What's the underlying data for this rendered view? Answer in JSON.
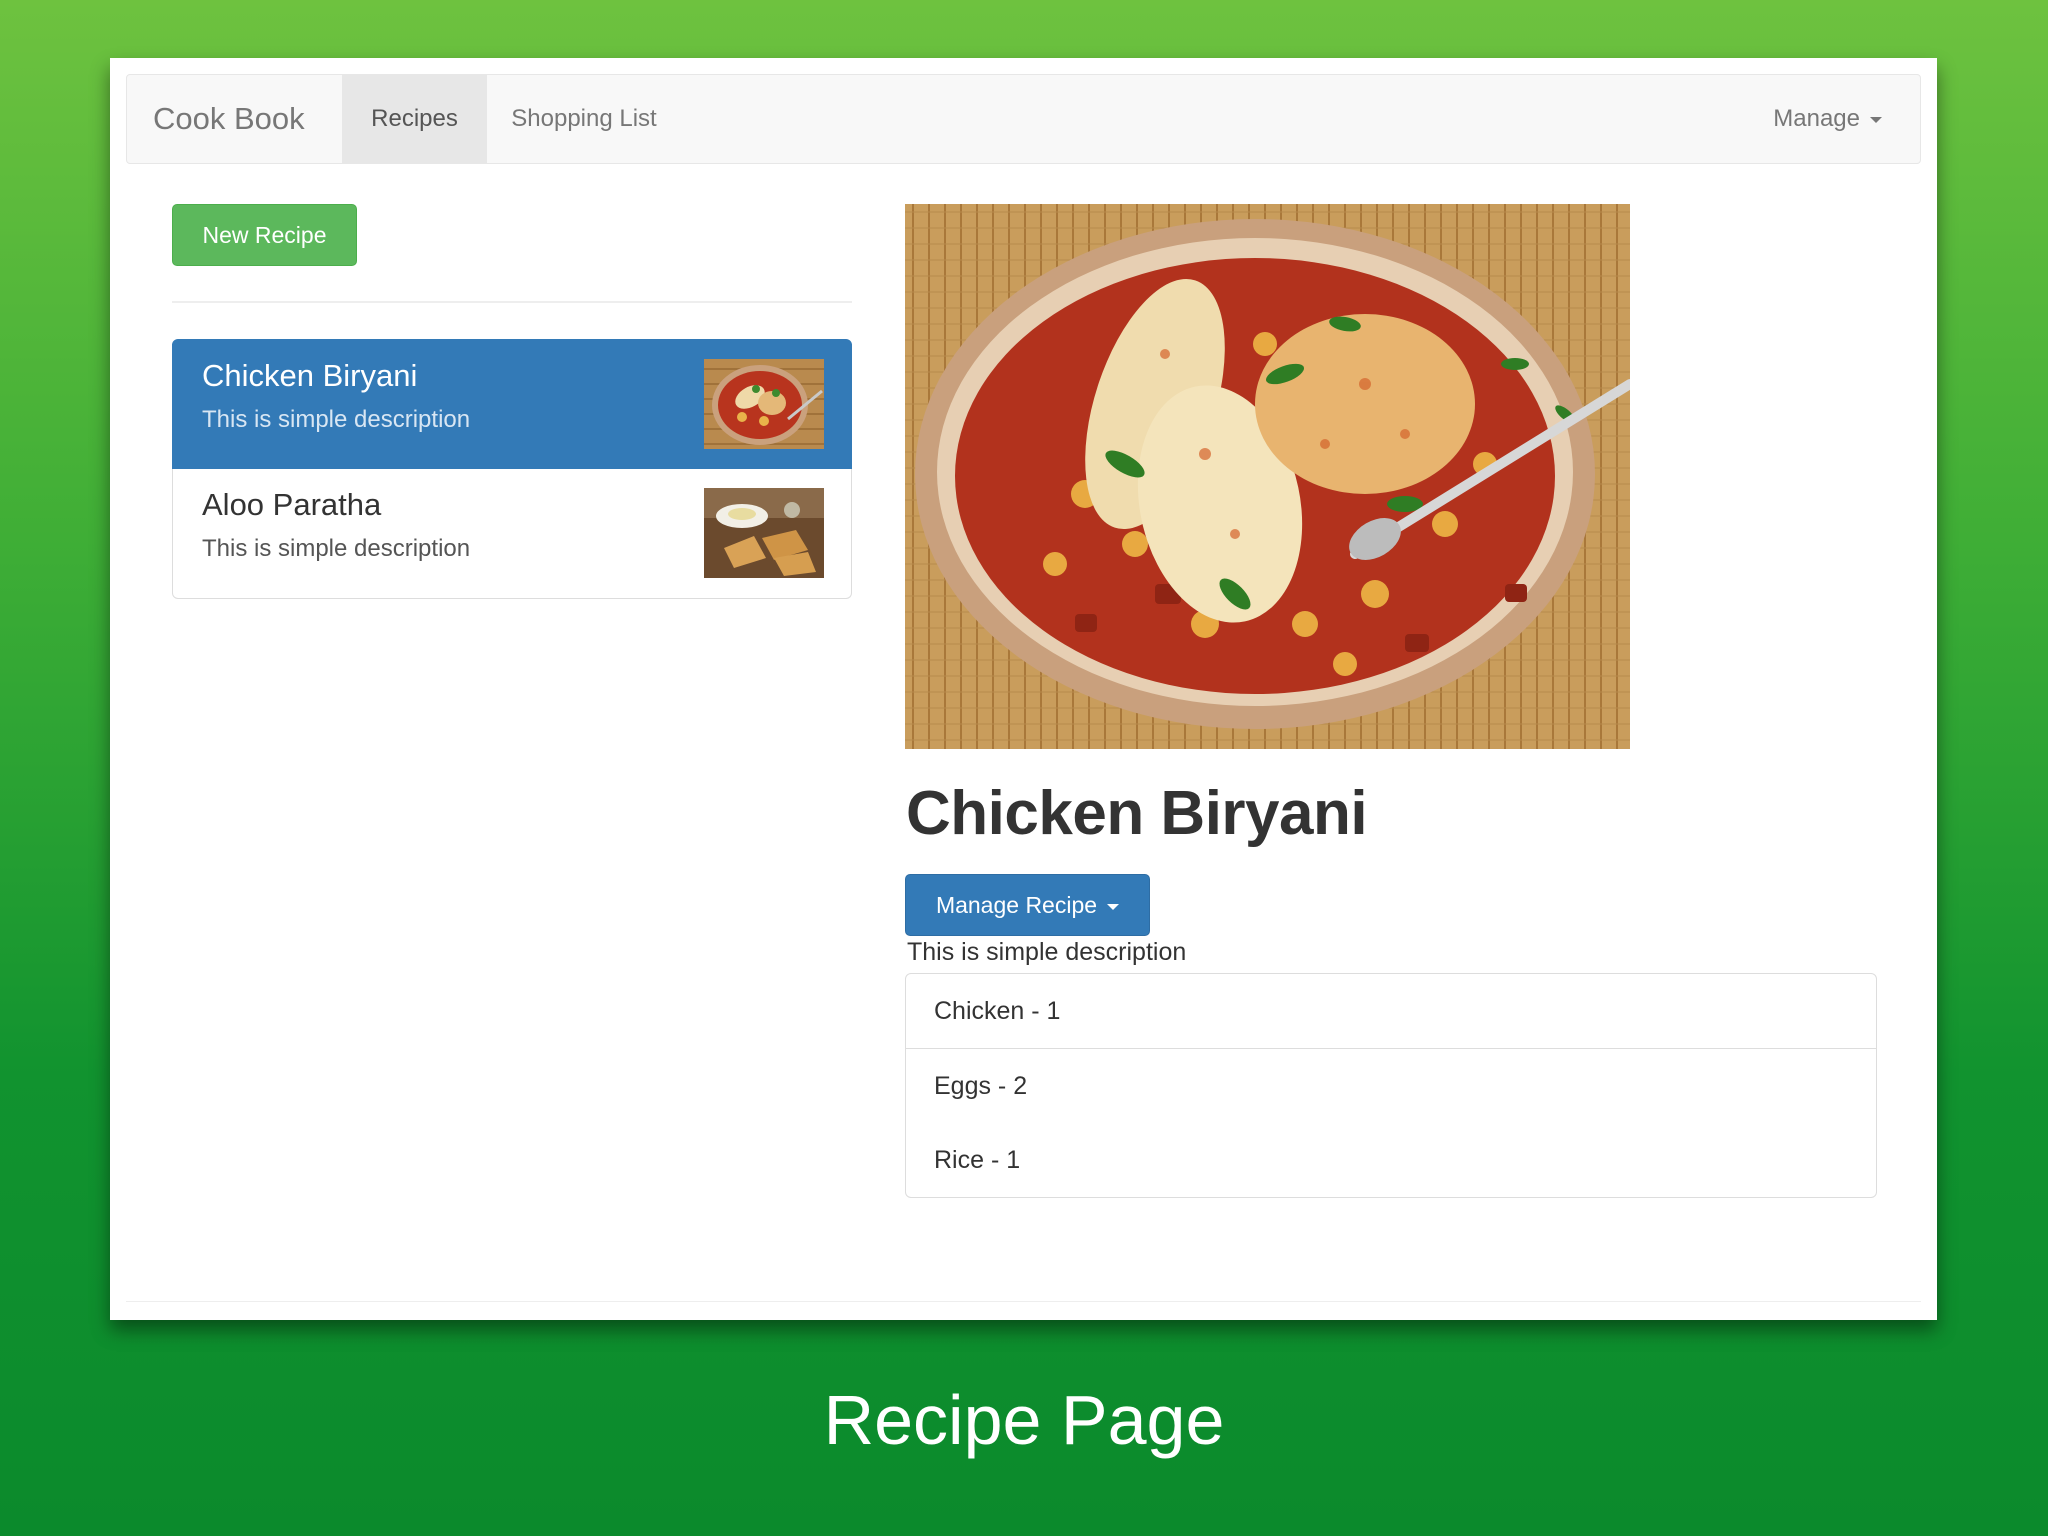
{
  "navbar": {
    "brand": "Cook Book",
    "tabs": [
      {
        "label": "Recipes",
        "active": true
      },
      {
        "label": "Shopping List",
        "active": false
      }
    ],
    "manage_label": "Manage"
  },
  "sidebar": {
    "new_recipe_label": "New Recipe",
    "recipes": [
      {
        "name": "Chicken Biryani",
        "description": "This is simple description",
        "active": true
      },
      {
        "name": "Aloo Paratha",
        "description": "This is simple description",
        "active": false
      }
    ]
  },
  "detail": {
    "title": "Chicken Biryani",
    "manage_button_label": "Manage Recipe",
    "description": "This is simple description",
    "ingredients": [
      "Chicken - 1",
      "Eggs - 2",
      "Rice - 1"
    ]
  },
  "caption": "Recipe Page",
  "colors": {
    "primary": "#337ab7",
    "success": "#5cb85c",
    "background_top": "#6ec23f",
    "background_bottom": "#0b8a2c"
  }
}
